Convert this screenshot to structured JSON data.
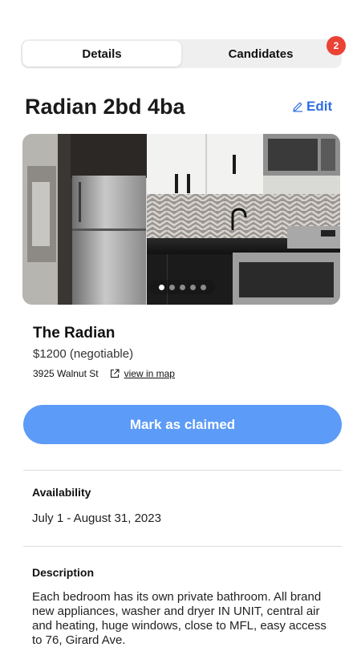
{
  "tabs": [
    {
      "label": "Details",
      "active": true
    },
    {
      "label": "Candidates",
      "active": false,
      "badge": "2"
    }
  ],
  "listing": {
    "title": "Radian 2bd 4ba",
    "edit_label": "Edit",
    "photo": {
      "count": 5,
      "current": 1
    },
    "name": "The Radian",
    "price": "$1200 (negotiable)",
    "address": "3925 Walnut St",
    "map_link": "view in map",
    "claim_label": "Mark as claimed"
  },
  "availability": {
    "heading": "Availability",
    "text": "July 1 - August 31, 2023"
  },
  "description": {
    "heading": "Description",
    "text": "Each bedroom has its own private bathroom. All brand new appliances, washer and dryer IN UNIT, central air and heating, huge windows, close to MFL, easy access to 76, Girard Ave."
  },
  "colors": {
    "accent": "#2f6fe4",
    "button": "#5c9bf7",
    "badge": "#ea4335"
  }
}
